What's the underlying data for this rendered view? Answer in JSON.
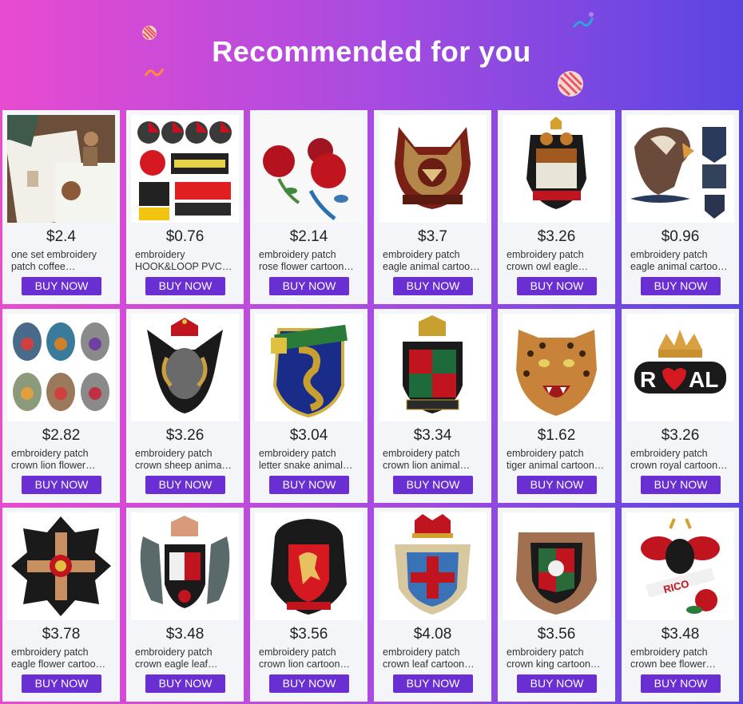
{
  "header": {
    "title": "Recommended for you"
  },
  "colors": {
    "button": "#6a2fd3",
    "gradient_left": "#e84bd0",
    "gradient_right": "#5a45e2"
  },
  "products": [
    {
      "price": "$2.4",
      "line1": "one set embroidery",
      "line2": "patch coffee…",
      "button": "BUY NOW",
      "icon": "coffee-patch-set"
    },
    {
      "price": "$0.76",
      "line1": "embroidery",
      "line2": "HOOK&LOOP PVC…",
      "button": "BUY NOW",
      "icon": "umbrella-patches"
    },
    {
      "price": "$2.14",
      "line1": "embroidery patch",
      "line2": "rose flower cartoon…",
      "button": "BUY NOW",
      "icon": "rose-patch"
    },
    {
      "price": "$3.7",
      "line1": "embroidery patch",
      "line2": "eagle animal cartoo…",
      "button": "BUY NOW",
      "icon": "eagle-badge-patch"
    },
    {
      "price": "$3.26",
      "line1": "embroidery patch",
      "line2": "crown owl eagle…",
      "button": "BUY NOW",
      "icon": "owl-crest-patch"
    },
    {
      "price": "$0.96",
      "line1": "embroidery patch",
      "line2": "eagle animal cartoo…",
      "button": "BUY NOW",
      "icon": "eagle-head-patch"
    },
    {
      "price": "$2.82",
      "line1": "embroidery patch",
      "line2": "crown lion flower…",
      "button": "BUY NOW",
      "icon": "oval-crest-set"
    },
    {
      "price": "$3.26",
      "line1": "embroidery patch",
      "line2": "crown sheep anima…",
      "button": "BUY NOW",
      "icon": "sheep-crest-patch"
    },
    {
      "price": "$3.04",
      "line1": "embroidery patch",
      "line2": "letter snake animal…",
      "button": "BUY NOW",
      "icon": "snake-crest-patch"
    },
    {
      "price": "$3.34",
      "line1": "embroidery patch",
      "line2": "crown lion animal…",
      "button": "BUY NOW",
      "icon": "lion-crest-patch"
    },
    {
      "price": "$1.62",
      "line1": "embroidery patch",
      "line2": "tiger animal cartoon…",
      "button": "BUY NOW",
      "icon": "tiger-patch"
    },
    {
      "price": "$3.26",
      "line1": "embroidery patch",
      "line2": "crown royal cartoon…",
      "button": "BUY NOW",
      "icon": "royal-patch"
    },
    {
      "price": "$3.78",
      "line1": "embroidery patch",
      "line2": "eagle flower cartoo…",
      "button": "BUY NOW",
      "icon": "cross-medal-patch"
    },
    {
      "price": "$3.48",
      "line1": "embroidery patch",
      "line2": "crown eagle leaf…",
      "button": "BUY NOW",
      "icon": "eagle-shield-patch"
    },
    {
      "price": "$3.56",
      "line1": "embroidery patch",
      "line2": "crown lion cartoon…",
      "button": "BUY NOW",
      "icon": "lion-shield-patch"
    },
    {
      "price": "$4.08",
      "line1": "embroidery patch",
      "line2": "crown leaf cartoon…",
      "button": "BUY NOW",
      "icon": "crown-shield-patch"
    },
    {
      "price": "$3.56",
      "line1": "embroidery patch",
      "line2": "crown king cartoon…",
      "button": "BUY NOW",
      "icon": "king-shield-patch"
    },
    {
      "price": "$3.48",
      "line1": "embroidery patch",
      "line2": "crown bee flower…",
      "button": "BUY NOW",
      "icon": "bee-patch"
    }
  ]
}
